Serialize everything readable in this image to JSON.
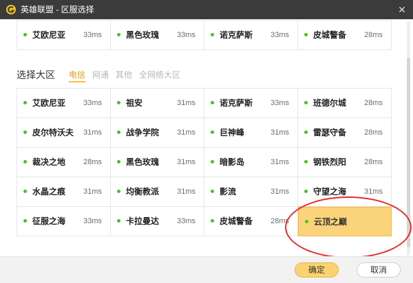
{
  "window": {
    "title": "英雄联盟 - 区服选择",
    "logo_icon": "league-logo-icon",
    "close_icon": "close-icon"
  },
  "recent_servers": [
    {
      "name": "艾欧尼亚",
      "ping": "33ms"
    },
    {
      "name": "黑色玫瑰",
      "ping": "33ms"
    },
    {
      "name": "诺克萨斯",
      "ping": "33ms"
    },
    {
      "name": "皮城警备",
      "ping": "28ms"
    }
  ],
  "section": {
    "label": "选择大区",
    "filters": [
      {
        "label": "电信",
        "active": true
      },
      {
        "label": "网通",
        "active": false
      },
      {
        "label": "其他",
        "active": false
      },
      {
        "label": "全网络大区",
        "active": false
      }
    ]
  },
  "servers": [
    {
      "name": "艾欧尼亚",
      "ping": "33ms"
    },
    {
      "name": "祖安",
      "ping": "31ms"
    },
    {
      "name": "诺克萨斯",
      "ping": "33ms"
    },
    {
      "name": "班德尔城",
      "ping": "28ms"
    },
    {
      "name": "皮尔特沃夫",
      "ping": "31ms"
    },
    {
      "name": "战争学院",
      "ping": "31ms"
    },
    {
      "name": "巨神峰",
      "ping": "31ms"
    },
    {
      "name": "雷瑟守备",
      "ping": "28ms"
    },
    {
      "name": "裁决之地",
      "ping": "28ms"
    },
    {
      "name": "黑色玫瑰",
      "ping": "31ms"
    },
    {
      "name": "暗影岛",
      "ping": "31ms"
    },
    {
      "name": "钢铁烈阳",
      "ping": "28ms"
    },
    {
      "name": "水晶之痕",
      "ping": "31ms"
    },
    {
      "name": "均衡教派",
      "ping": "31ms"
    },
    {
      "name": "影流",
      "ping": "31ms"
    },
    {
      "name": "守望之海",
      "ping": "31ms"
    },
    {
      "name": "征服之海",
      "ping": "33ms"
    },
    {
      "name": "卡拉曼达",
      "ping": "33ms"
    },
    {
      "name": "皮城警备",
      "ping": "28ms"
    },
    {
      "name": "云顶之巅",
      "ping": "",
      "selected": true
    }
  ],
  "footer": {
    "confirm_label": "确定",
    "cancel_label": "取消"
  },
  "colors": {
    "titlebar": "#3b3b3b",
    "status_dot": "#43c51a",
    "selected_bg": "#fbd37a",
    "accent": "#f5bd3a",
    "annotation": "#e62b2b"
  }
}
